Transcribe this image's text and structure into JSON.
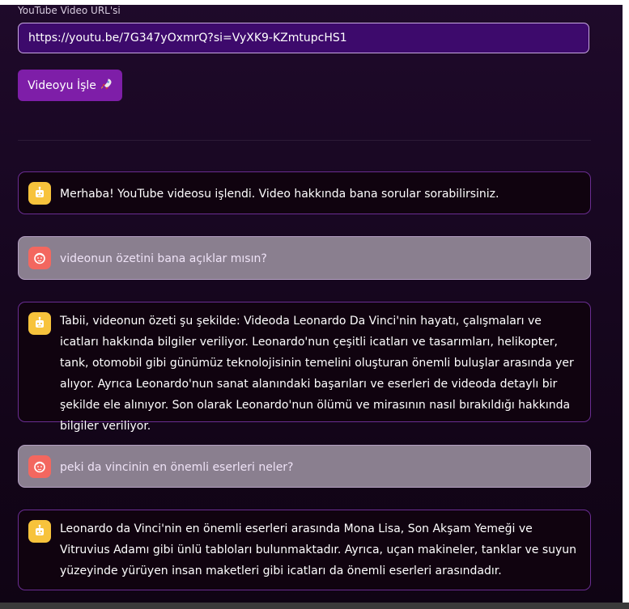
{
  "url_field": {
    "label": "YouTube Video URL'si",
    "value": "https://youtu.be/7G347yOxmrQ?si=VyXK9-KZmtupcHS1"
  },
  "process_button": {
    "label": "Videoyu İşle",
    "icon": "rocket-icon"
  },
  "colors": {
    "accent": "#7e1ea8",
    "input_bg": "#3d0a6c",
    "bot_avatar": "#f7c33c",
    "user_avatar": "#f3675f",
    "user_bubble": "#8a7f8f"
  },
  "messages": [
    {
      "role": "assistant",
      "avatar_icon": "robot-icon",
      "text": "Merhaba! YouTube videosu işlendi. Video hakkında bana sorular sorabilirsiniz."
    },
    {
      "role": "user",
      "avatar_icon": "user-face-icon",
      "text": "videonun özetini bana açıklar mısın?"
    },
    {
      "role": "assistant",
      "avatar_icon": "robot-icon",
      "text": "Tabii, videonun özeti şu şekilde: Videoda Leonardo Da Vinci'nin hayatı, çalışmaları ve icatları hakkında bilgiler veriliyor. Leonardo'nun çeşitli icatları ve tasarımları, helikopter, tank, otomobil gibi günümüz teknolojisinin temelini oluşturan önemli buluşlar arasında yer alıyor. Ayrıca Leonardo'nun sanat alanındaki başarıları ve eserleri de videoda detaylı bir şekilde ele alınıyor. Son olarak Leonardo'nun ölümü ve mirasının nasıl bırakıldığı hakkında bilgiler veriliyor."
    },
    {
      "role": "user",
      "avatar_icon": "user-face-icon",
      "text": "peki da vincinin en önemli eserleri neler?"
    },
    {
      "role": "assistant",
      "avatar_icon": "robot-icon",
      "text": "Leonardo da Vinci'nin en önemli eserleri arasında Mona Lisa, Son Akşam Yemeği ve Vitruvius Adamı gibi ünlü tabloları bulunmaktadır. Ayrıca, uçan makineler, tanklar ve suyun yüzeyinde yürüyen insan maketleri gibi icatları da önemli eserleri arasındadır."
    }
  ]
}
